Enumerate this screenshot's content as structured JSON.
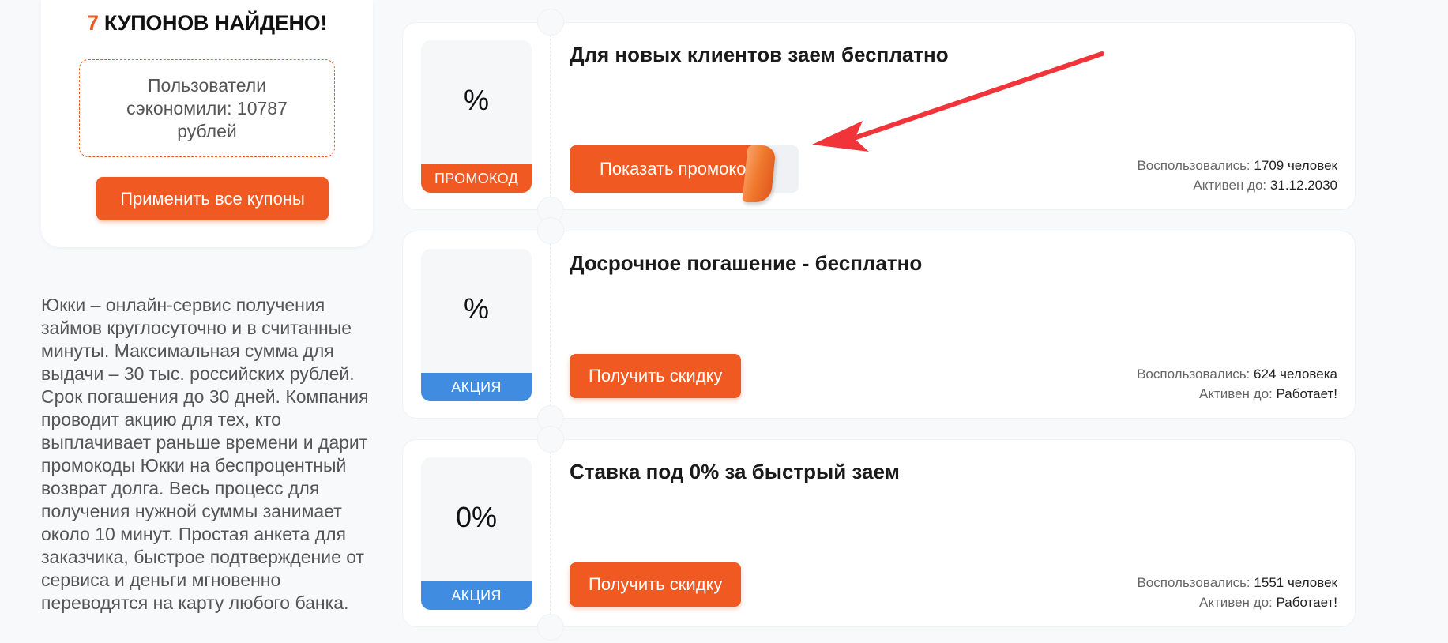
{
  "summary": {
    "count": "7",
    "found_label": "КУПОНОВ НАЙДЕНО!",
    "savings_text": "Пользователи сэкономили: 10787 рублей",
    "apply_all_label": "Применить все купоны"
  },
  "description": "Юкки – онлайн-сервис получения займов круглосуточно и в считанные минуты. Максимальная сумма для выдачи – 30 тыс. российских рублей. Срок погашения до 30 дней. Компания проводит акцию для тех, кто выплачивает раньше времени и дарит промокоды Юкки на беспроцентный возврат долга. Весь процесс для получения нужной суммы занимает около 10 минут. Простая анкета для заказчика, быстрое подтверждение от сервиса и деньги мгновенно переводятся на карту любого банка.",
  "coupons": [
    {
      "badge_value": "%",
      "badge_type": "ПРОМОКОД",
      "title": "Для новых клиентов заем бесплатно",
      "button_label": "Показать промокод",
      "used_label": "Воспользовались:",
      "used_value": "1709 человек",
      "active_label": "Активен до:",
      "active_value": "31.12.2030"
    },
    {
      "badge_value": "%",
      "badge_type": "АКЦИЯ",
      "title": "Досрочное погашение - бесплатно",
      "button_label": "Получить скидку",
      "used_label": "Воспользовались:",
      "used_value": "624 человека",
      "active_label": "Активен до:",
      "active_value": "Работает!"
    },
    {
      "badge_value": "0%",
      "badge_type": "АКЦИЯ",
      "title": "Ставка под 0% за быстрый заем",
      "button_label": "Получить скидку",
      "used_label": "Воспользовались:",
      "used_value": "1551 человек",
      "active_label": "Активен до:",
      "active_value": "Работает!"
    }
  ],
  "colors": {
    "accent": "#f05a22",
    "action_badge": "#3f8ce0",
    "arrow": "#f0343a"
  }
}
